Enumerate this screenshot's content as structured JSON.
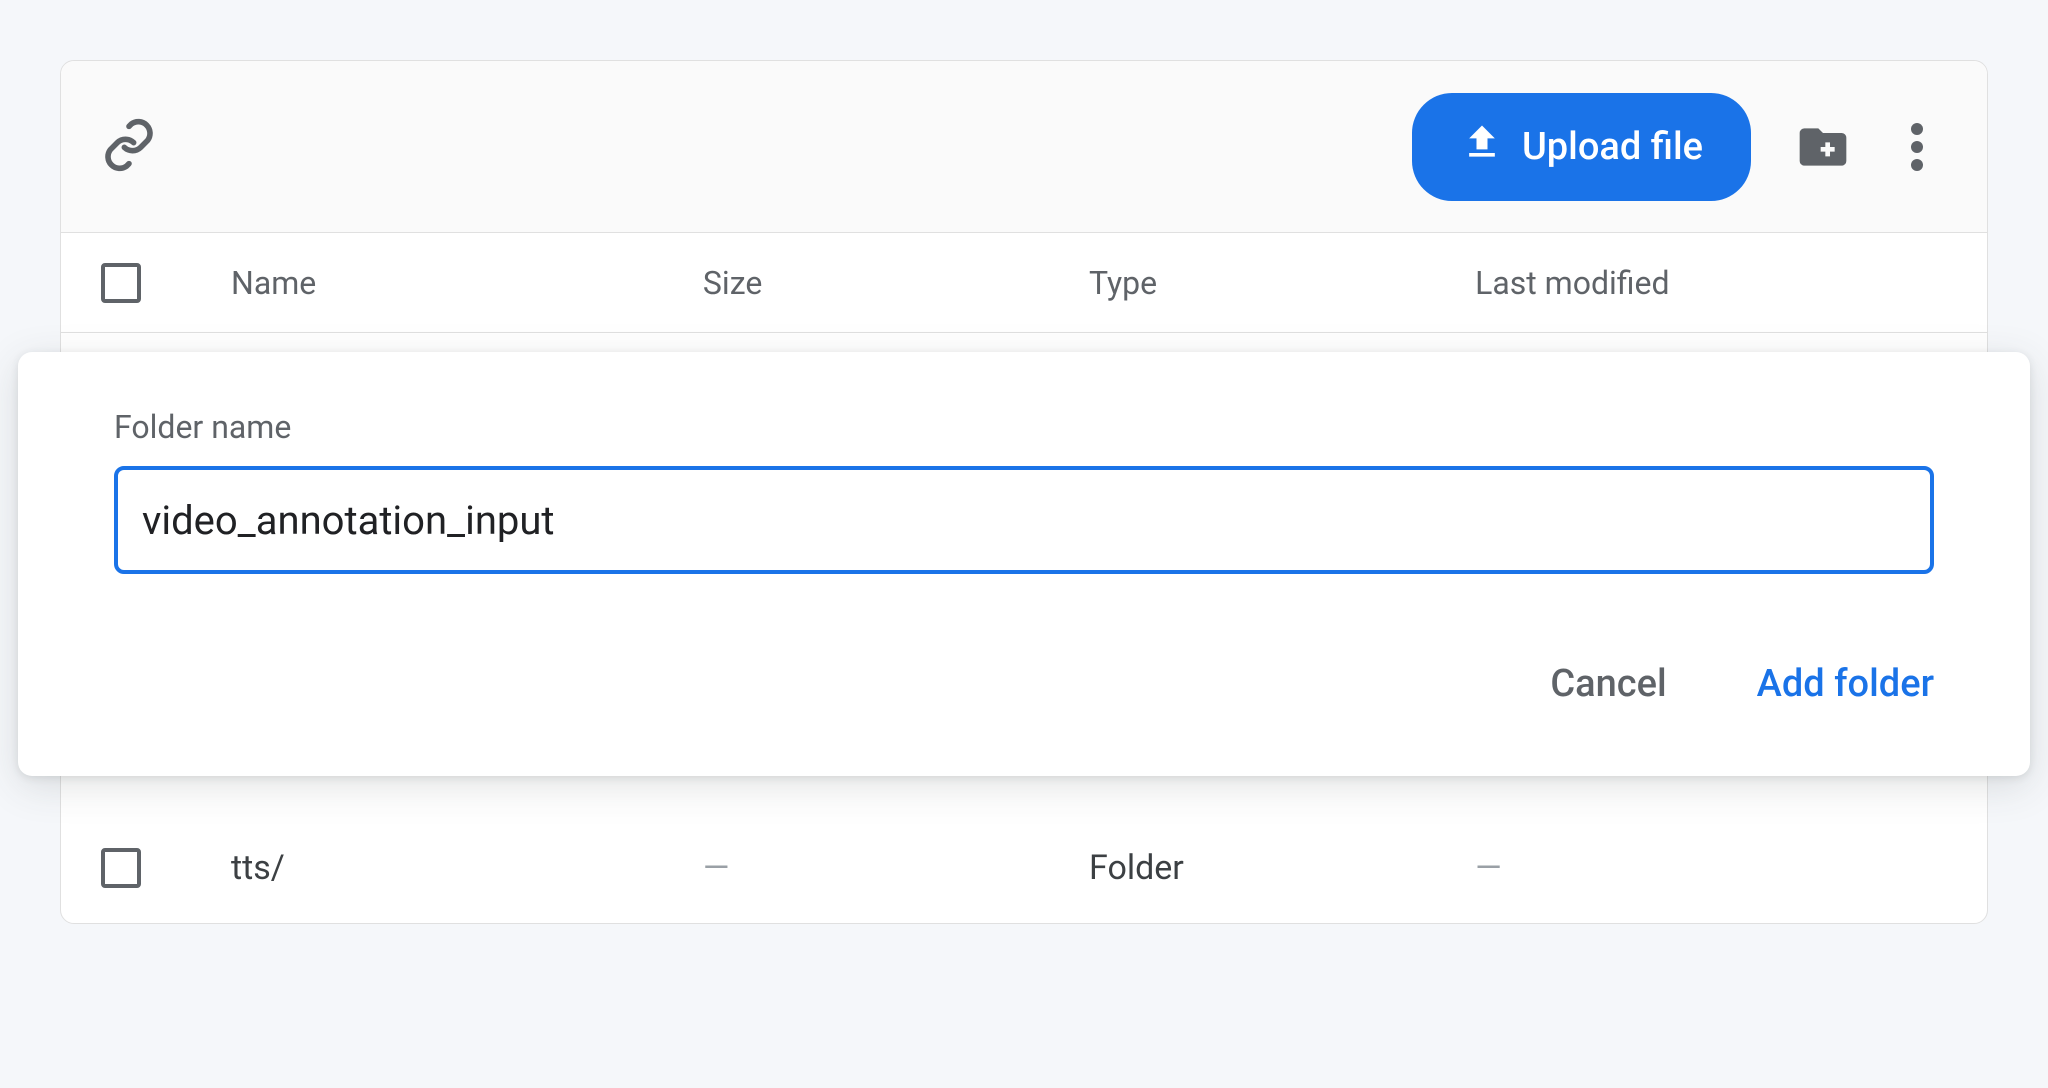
{
  "toolbar": {
    "upload_label": "Upload file"
  },
  "columns": {
    "name": "Name",
    "size": "Size",
    "type": "Type",
    "modified": "Last modified"
  },
  "rows": [
    {
      "name": "tts/",
      "size": "—",
      "type": "Folder",
      "modified": "—"
    }
  ],
  "dialog": {
    "label": "Folder name",
    "value": "video_annotation_input",
    "cancel": "Cancel",
    "confirm": "Add folder"
  }
}
